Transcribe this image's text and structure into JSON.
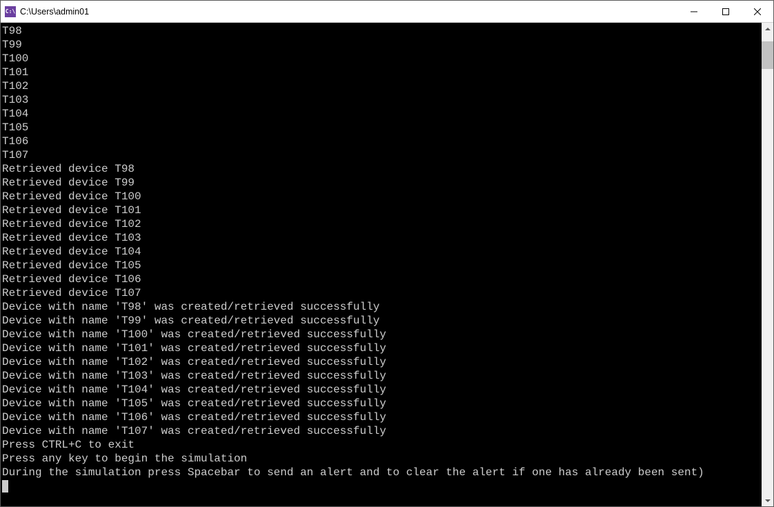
{
  "window": {
    "title": "C:\\Users\\admin01",
    "icon_text": "C:\\"
  },
  "console": {
    "lines": [
      "T98",
      "T99",
      "T100",
      "T101",
      "T102",
      "T103",
      "T104",
      "T105",
      "T106",
      "T107",
      "Retrieved device T98",
      "Retrieved device T99",
      "Retrieved device T100",
      "Retrieved device T101",
      "Retrieved device T102",
      "Retrieved device T103",
      "Retrieved device T104",
      "Retrieved device T105",
      "Retrieved device T106",
      "Retrieved device T107",
      "Device with name 'T98' was created/retrieved successfully",
      "Device with name 'T99' was created/retrieved successfully",
      "Device with name 'T100' was created/retrieved successfully",
      "Device with name 'T101' was created/retrieved successfully",
      "Device with name 'T102' was created/retrieved successfully",
      "Device with name 'T103' was created/retrieved successfully",
      "Device with name 'T104' was created/retrieved successfully",
      "Device with name 'T105' was created/retrieved successfully",
      "Device with name 'T106' was created/retrieved successfully",
      "Device with name 'T107' was created/retrieved successfully",
      "Press CTRL+C to exit",
      "Press any key to begin the simulation",
      "During the simulation press Spacebar to send an alert and to clear the alert if one has already been sent)"
    ]
  }
}
